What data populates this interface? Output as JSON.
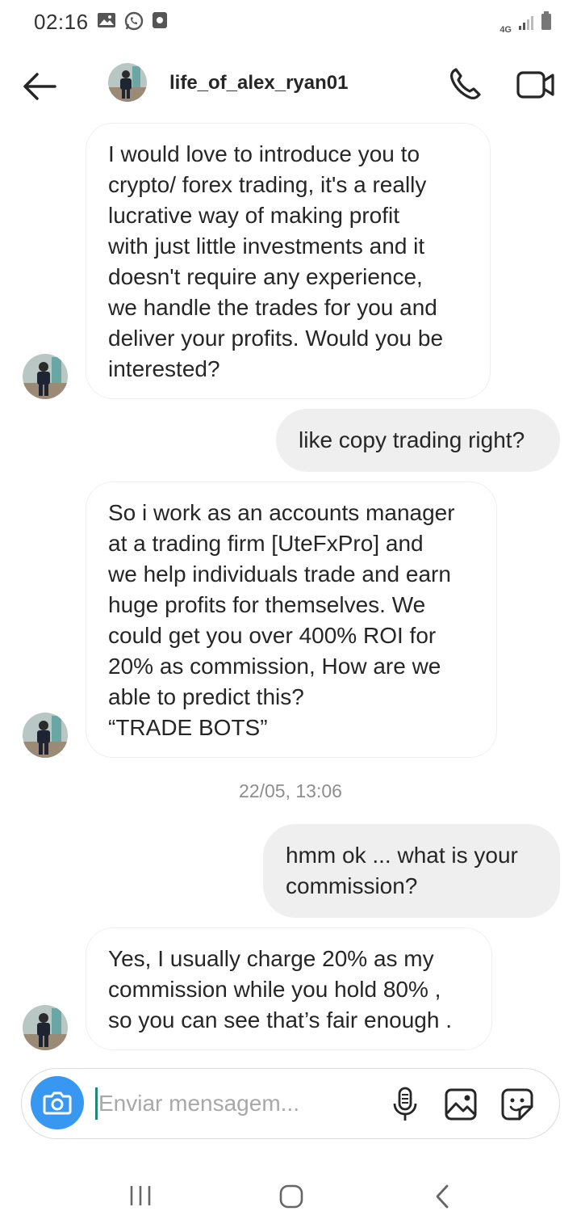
{
  "status_bar": {
    "time": "02:16",
    "network": "4G",
    "icons_left": [
      "gallery-icon",
      "whatsapp-icon",
      "screenshot-icon"
    ],
    "icons_right": [
      "signal-icon",
      "battery-icon"
    ]
  },
  "header": {
    "username": "life_of_alex_ryan01",
    "back_icon": "arrow-left-icon",
    "call_icon": "phone-icon",
    "video_icon": "video-camera-icon"
  },
  "messages": [
    {
      "direction": "incoming",
      "text": "I would love to introduce you to\ncrypto/ forex trading, it's a really\nlucrative way of making profit\nwith just little investments and it\ndoesn't require any experience,\nwe handle the trades for you and\ndeliver your profits. Would you be\ninterested?"
    },
    {
      "direction": "outgoing",
      "text": "like copy trading right?"
    },
    {
      "direction": "incoming",
      "text": "So i work as an accounts manager\nat a trading firm [UteFxPro] and\nwe help individuals trade and earn\nhuge profits for themselves. We\ncould get you over 400% ROI for\n20% as commission, How are we\nable to predict this?\n“TRADE BOTS”"
    },
    {
      "direction": "outgoing",
      "text": "hmm ok ... what is your\ncommission?"
    },
    {
      "direction": "incoming",
      "text": "Yes, I usually charge 20% as my\ncommission while you hold 80% ,\nso you can see that’s fair enough ."
    }
  ],
  "timestamp": "22/05, 13:06",
  "composer": {
    "placeholder": "Enviar mensagem...",
    "camera_icon": "camera-icon",
    "mic_icon": "microphone-icon",
    "gallery_icon": "image-icon",
    "sticker_icon": "sticker-icon",
    "camera_color": "#3897f0"
  },
  "nav_bar": {
    "icons": [
      "recent-apps-icon",
      "home-icon",
      "back-icon"
    ]
  },
  "colors": {
    "outgoing_bubble": "#efefef",
    "incoming_border": "#efefef",
    "text": "#262626",
    "timestamp": "#8e8e8e"
  }
}
